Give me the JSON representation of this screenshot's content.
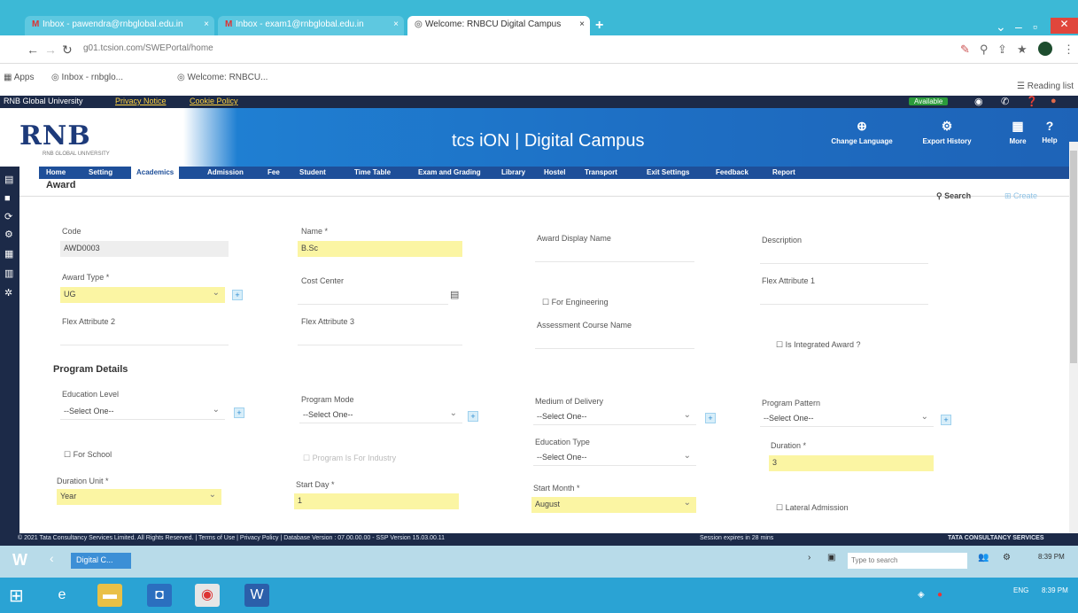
{
  "browser": {
    "tabs": [
      {
        "label": "Inbox - pawendra@rnbglobal.edu.in",
        "active": false
      },
      {
        "label": "Inbox - exam1@rnbglobal.edu.in",
        "active": false
      },
      {
        "label": "Welcome: RNBCU Digital Campus",
        "active": true
      }
    ],
    "url": "g01.tcsion.com/SWEPortal/home",
    "bookmarks": [
      "Apps",
      "Inbox - rnbglo...",
      "Welcome: RNBCU..."
    ],
    "reading_list": "Reading list"
  },
  "app": {
    "top_links": [
      "RNB Global University",
      "Privacy Notice",
      "Cookie Policy"
    ],
    "status": "Available",
    "logo": "RNB",
    "logo_sub": "RNB GLOBAL UNIVERSITY",
    "title": "tcs iON | Digital Campus",
    "header_buttons": [
      "Change Language",
      "Export History",
      "More",
      "Help"
    ],
    "nav": [
      "Home",
      "Setting",
      "Academics",
      "Admission",
      "Fee",
      "Student",
      "Time Table",
      "Exam and Grading",
      "Library",
      "Hostel",
      "Transport",
      "Exit Settings",
      "Feedback",
      "Report"
    ],
    "nav_active": "Academics"
  },
  "page": {
    "title": "Award",
    "search_label": "Search",
    "create_label": "Create",
    "fields": {
      "code_label": "Code",
      "code_value": "AWD0003",
      "name_label": "Name *",
      "name_value": "B.Sc",
      "award_display_label": "Award Display Name",
      "description_label": "Description",
      "award_type_label": "Award Type *",
      "award_type_value": "UG",
      "cost_center_label": "Cost Center",
      "for_engineering_label": "For Engineering",
      "flex1_label": "Flex Attribute 1",
      "flex2_label": "Flex Attribute 2",
      "flex3_label": "Flex Attribute 3",
      "assessment_label": "Assessment Course Name",
      "integrated_label": "Is Integrated Award ?"
    },
    "program_section": "Program Details",
    "program": {
      "education_level_label": "Education Level",
      "education_level_value": "--Select One--",
      "program_mode_label": "Program Mode",
      "program_mode_value": "--Select One--",
      "medium_label": "Medium of Delivery",
      "medium_value": "--Select One--",
      "pattern_label": "Program Pattern",
      "pattern_value": "--Select One--",
      "for_school_label": "For School",
      "industry_label": "Program Is For Industry",
      "education_type_label": "Education Type",
      "education_type_value": "--Select One--",
      "duration_label": "Duration *",
      "duration_value": "3",
      "duration_unit_label": "Duration Unit *",
      "duration_unit_value": "Year",
      "start_day_label": "Start Day *",
      "start_day_value": "1",
      "start_month_label": "Start Month *",
      "start_month_value": "August",
      "lateral_label": "Lateral Admission"
    }
  },
  "footer": {
    "copyright": "© 2021 Tata Consultancy Services Limited. All Rights Reserved. | Terms of Use | Privacy Policy | Database Version : 07.00.00.00 - SSP Version 15.03.00.11",
    "session": "Session expires in 28 mins",
    "brand": "TATA CONSULTANCY SERVICES"
  },
  "taskbar": {
    "task_label": "Digital C...",
    "search_placeholder": "Type to search",
    "time": "8:39 PM",
    "lang": "ENG"
  }
}
